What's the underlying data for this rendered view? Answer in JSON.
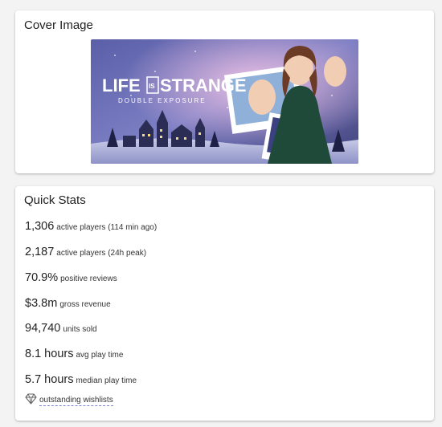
{
  "cover": {
    "title": "Cover Image",
    "logo_line1_a": "LIFE",
    "logo_is": "IS",
    "logo_line1_b": "STRANGE",
    "logo_line2": "DOUBLE EXPOSURE"
  },
  "stats": {
    "title": "Quick Stats",
    "items": [
      {
        "value": "1,306",
        "label": "active players (114 min ago)"
      },
      {
        "value": "2,187",
        "label": "active players (24h peak)"
      },
      {
        "value": "70.9%",
        "label": "positive reviews"
      },
      {
        "value": "$3.8m",
        "label": "gross revenue"
      },
      {
        "value": "94,740",
        "label": "units sold"
      },
      {
        "value": "8.1 hours",
        "label": "avg play time"
      },
      {
        "value": "5.7 hours",
        "label": "median play time"
      }
    ],
    "wishlist_icon": "diamond-icon",
    "wishlist_label": "outstanding wishlists"
  }
}
